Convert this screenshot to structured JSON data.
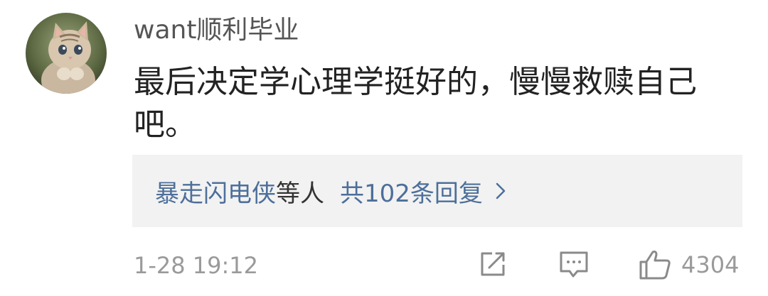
{
  "comment": {
    "avatar_icon": "cat-avatar-icon",
    "username": "want顺利毕业",
    "text": "最后决定学心理学挺好的，慢慢救赎自己吧。"
  },
  "replies": {
    "repliers": "暴走闪电侠",
    "and_others": "等人",
    "count_text": "共102条回复",
    "chevron_icon": "chevron-right-icon"
  },
  "footer": {
    "timestamp": "1-28 19:12",
    "share_icon": "share-icon",
    "comment_icon": "comment-icon",
    "like_icon": "thumbs-up-icon",
    "like_count": "4304"
  },
  "colors": {
    "link": "#4d6f9a",
    "reply_bg": "#f2f2f2",
    "meta_text": "#9a9a9a"
  }
}
